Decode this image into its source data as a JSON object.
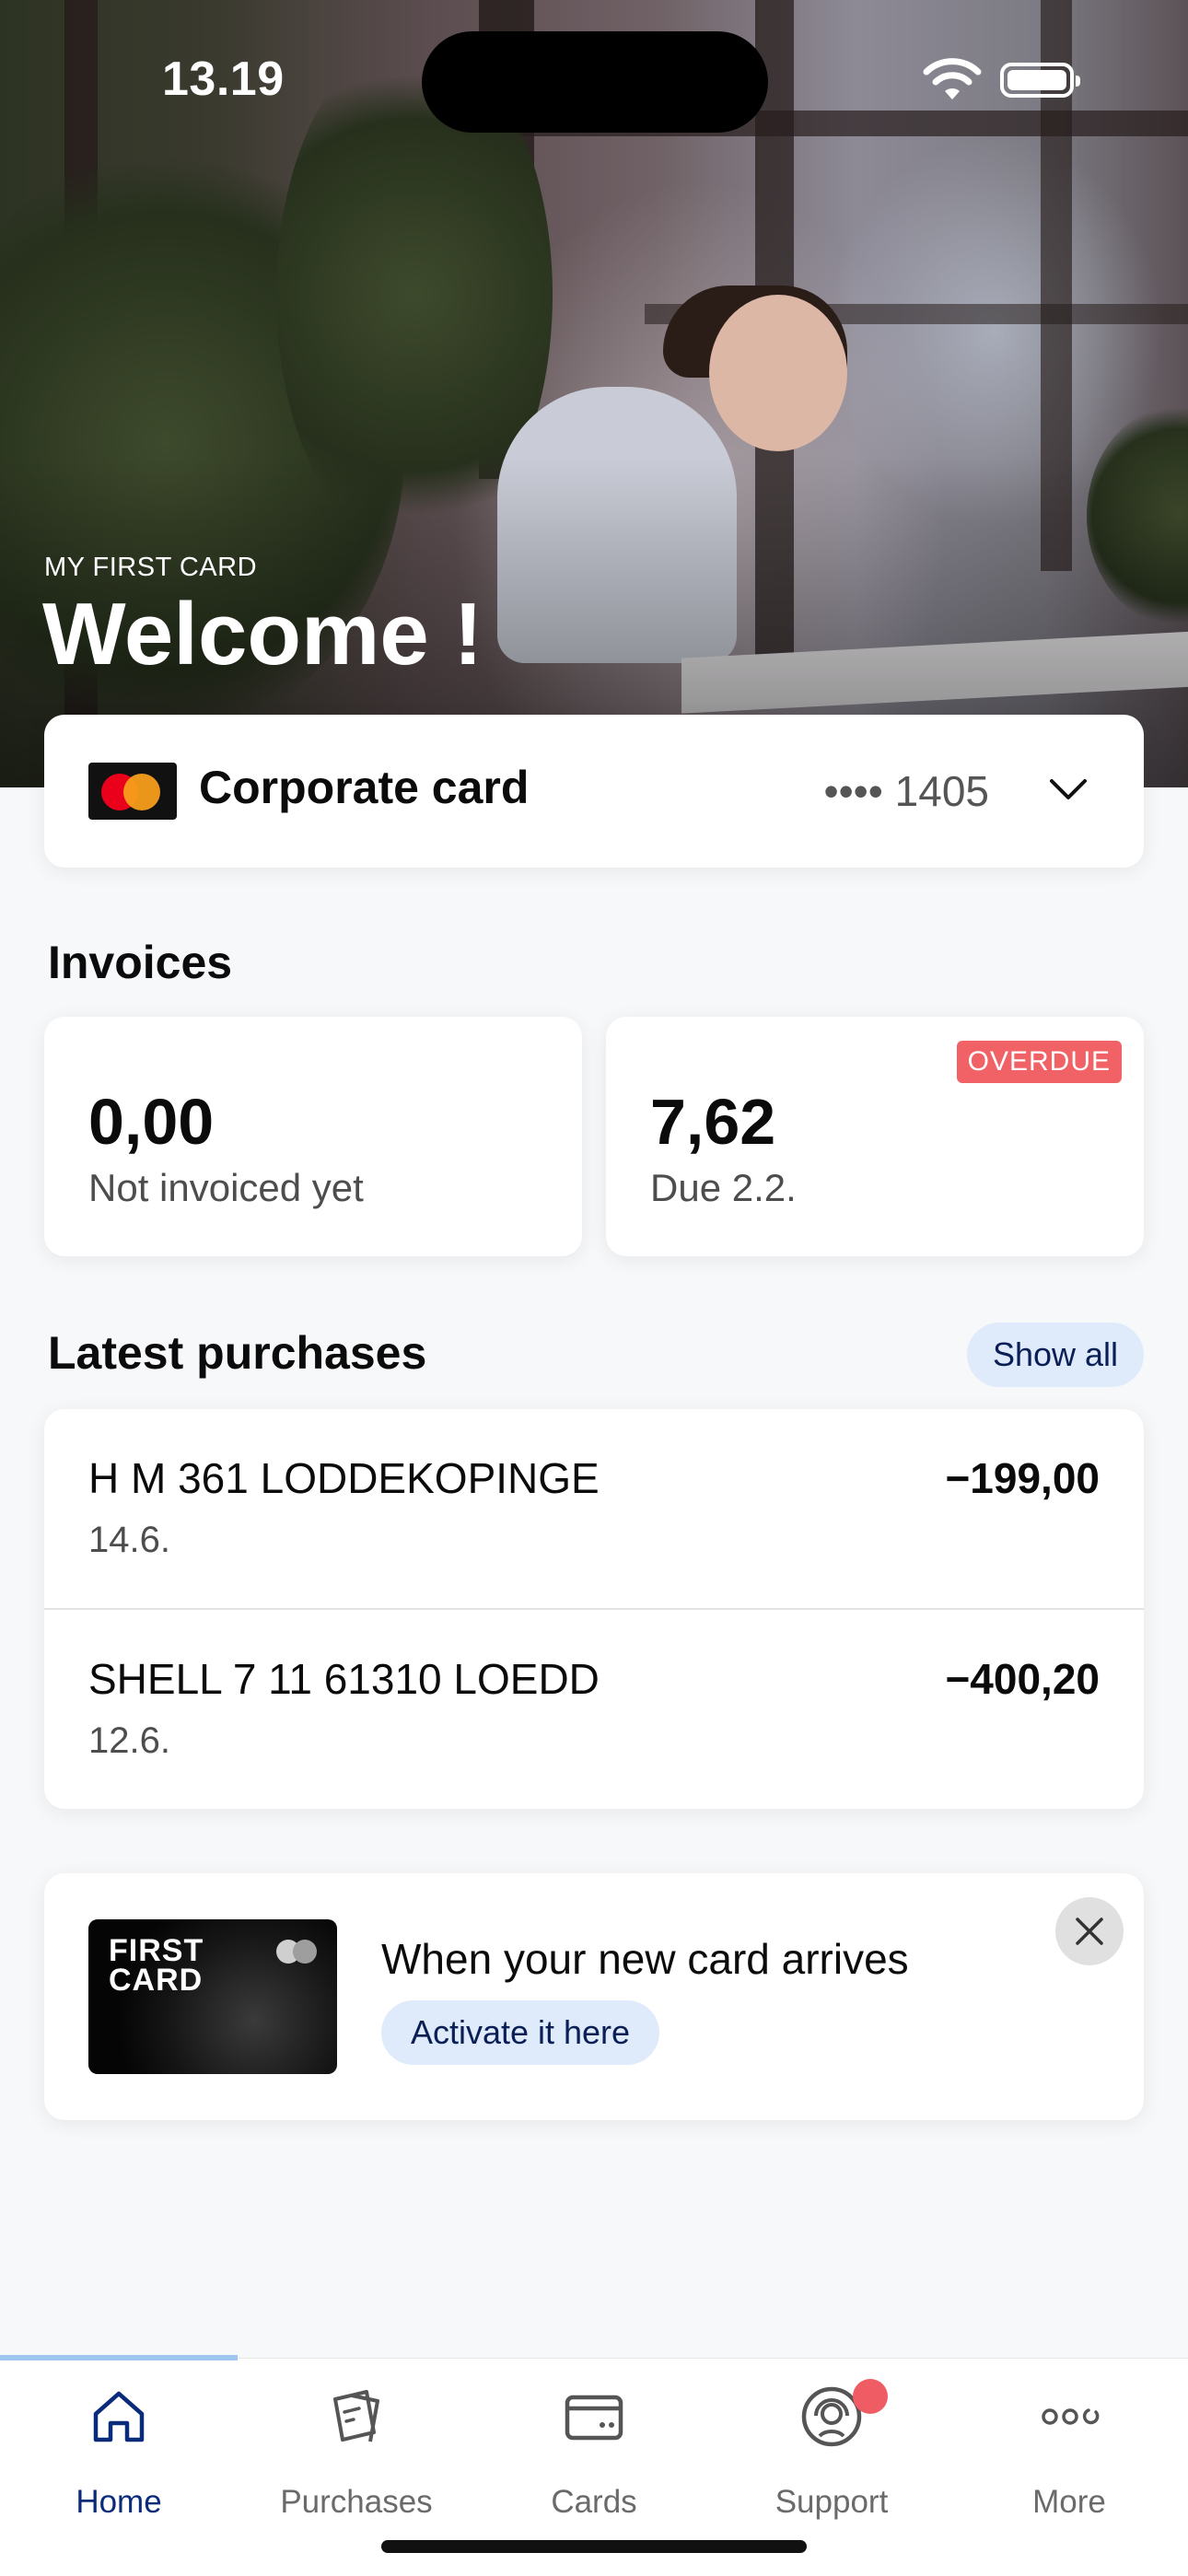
{
  "status_bar": {
    "time": "13.19"
  },
  "hero": {
    "label": "MY FIRST CARD",
    "title": "Welcome !"
  },
  "card_selector": {
    "name": "Corporate card",
    "number": "•••• 1405"
  },
  "invoices": {
    "title": "Invoices",
    "items": [
      {
        "amount": "0,00",
        "subtitle": "Not invoiced yet"
      },
      {
        "amount": "7,62",
        "subtitle": "Due 2.2.",
        "badge": "OVERDUE"
      }
    ]
  },
  "latest_purchases": {
    "title": "Latest purchases",
    "show_all_label": "Show all",
    "items": [
      {
        "name": "H M 361 LODDEKOPINGE",
        "date": "14.6.",
        "amount": "−199,00"
      },
      {
        "name": "SHELL 7 11 61310 LOEDD",
        "date": "12.6.",
        "amount": "−400,20"
      }
    ]
  },
  "promo": {
    "card_text_line1": "FIRST",
    "card_text_line2": "CARD",
    "title": "When your new card arrives",
    "button_label": "Activate it here"
  },
  "tab_bar": {
    "items": [
      {
        "label": "Home",
        "icon": "home-icon",
        "active": true
      },
      {
        "label": "Purchases",
        "icon": "receipt-icon"
      },
      {
        "label": "Cards",
        "icon": "card-icon"
      },
      {
        "label": "Support",
        "icon": "headset-icon",
        "has_notification": true
      },
      {
        "label": "More",
        "icon": "more-icon"
      }
    ]
  },
  "colors": {
    "accent_navy": "#0a2a7a",
    "chip_blue": "#dfeafb",
    "overdue_red": "#f06266",
    "notification_red": "#f05c64"
  }
}
